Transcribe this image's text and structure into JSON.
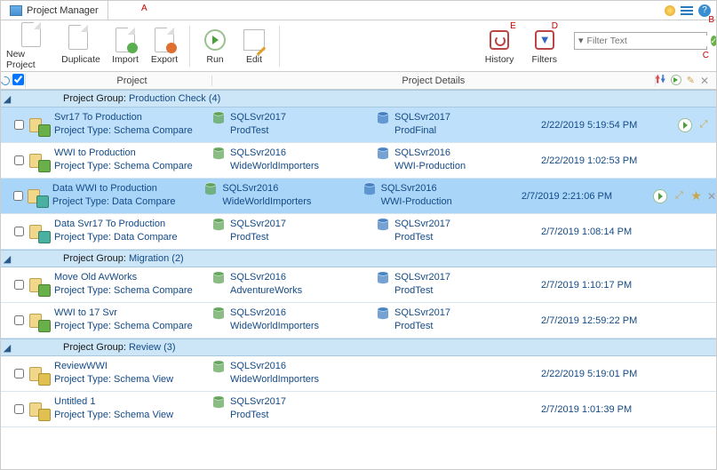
{
  "title": "Project Manager",
  "annotations": {
    "a": "A",
    "b": "B",
    "c": "C",
    "d": "D",
    "e": "E"
  },
  "toolbar": {
    "new_project": "New Project",
    "duplicate": "Duplicate",
    "import": "Import",
    "export": "Export",
    "run": "Run",
    "edit": "Edit",
    "history": "History",
    "filters": "Filters"
  },
  "filter": {
    "placeholder": "Filter Text"
  },
  "columns": {
    "project": "Project",
    "details": "Project Details"
  },
  "group_label": "Project Group:",
  "project_type_label": "Project Type:",
  "groups": [
    {
      "name": "Production Check",
      "count": 4,
      "rows": [
        {
          "selected": true,
          "icon": "compare-green",
          "name": "Svr17 To Production",
          "type": "Schema Compare",
          "src": {
            "server": "SQLSvr2017",
            "db": "ProdTest"
          },
          "tgt": {
            "server": "SQLSvr2017",
            "db": "ProdFinal"
          },
          "time": "2/22/2019 5:19:54 PM",
          "actions": [
            "play",
            "open"
          ]
        },
        {
          "selected": false,
          "icon": "compare-green",
          "name": "WWI to Production",
          "type": "Schema Compare",
          "src": {
            "server": "SQLSvr2016",
            "db": "WideWorldImporters"
          },
          "tgt": {
            "server": "SQLSvr2016",
            "db": "WWI-Production"
          },
          "time": "2/22/2019 1:02:53 PM",
          "actions": []
        },
        {
          "selected": true,
          "dark": true,
          "icon": "compare-teal",
          "name": "Data WWI to Production",
          "type": "Data Compare",
          "src": {
            "server": "SQLSvr2016",
            "db": "WideWorldImporters"
          },
          "tgt": {
            "server": "SQLSvr2016",
            "db": "WWI-Production"
          },
          "time": "2/7/2019 2:21:06 PM",
          "actions": [
            "play",
            "open",
            "star",
            "delete"
          ]
        },
        {
          "selected": false,
          "icon": "compare-teal",
          "name": "Data Svr17 To Production",
          "type": "Data Compare",
          "src": {
            "server": "SQLSvr2017",
            "db": "ProdTest"
          },
          "tgt": {
            "server": "SQLSvr2017",
            "db": "ProdTest"
          },
          "time": "2/7/2019 1:08:14 PM",
          "actions": []
        }
      ]
    },
    {
      "name": "Migration",
      "count": 2,
      "rows": [
        {
          "selected": false,
          "icon": "compare-green",
          "name": "Move Old AvWorks",
          "type": "Schema Compare",
          "src": {
            "server": "SQLSvr2016",
            "db": "AdventureWorks"
          },
          "tgt": {
            "server": "SQLSvr2017",
            "db": "ProdTest"
          },
          "time": "2/7/2019 1:10:17 PM",
          "actions": []
        },
        {
          "selected": false,
          "icon": "compare-green",
          "name": "WWI to 17 Svr",
          "type": "Schema Compare",
          "src": {
            "server": "SQLSvr2016",
            "db": "WideWorldImporters"
          },
          "tgt": {
            "server": "SQLSvr2017",
            "db": "ProdTest"
          },
          "time": "2/7/2019 12:59:22 PM",
          "actions": []
        }
      ]
    },
    {
      "name": "Review",
      "count": 3,
      "rows": [
        {
          "selected": false,
          "icon": "view-yellow",
          "name": "ReviewWWI",
          "type": "Schema View",
          "src": {
            "server": "SQLSvr2016",
            "db": "WideWorldImporters"
          },
          "tgt": null,
          "time": "2/22/2019 5:19:01 PM",
          "actions": []
        },
        {
          "selected": false,
          "icon": "view-yellow",
          "name": "Untitled 1",
          "type": "Schema View",
          "src": {
            "server": "SQLSvr2017",
            "db": "ProdTest"
          },
          "tgt": null,
          "time": "2/7/2019 1:01:39 PM",
          "actions": []
        }
      ]
    }
  ]
}
